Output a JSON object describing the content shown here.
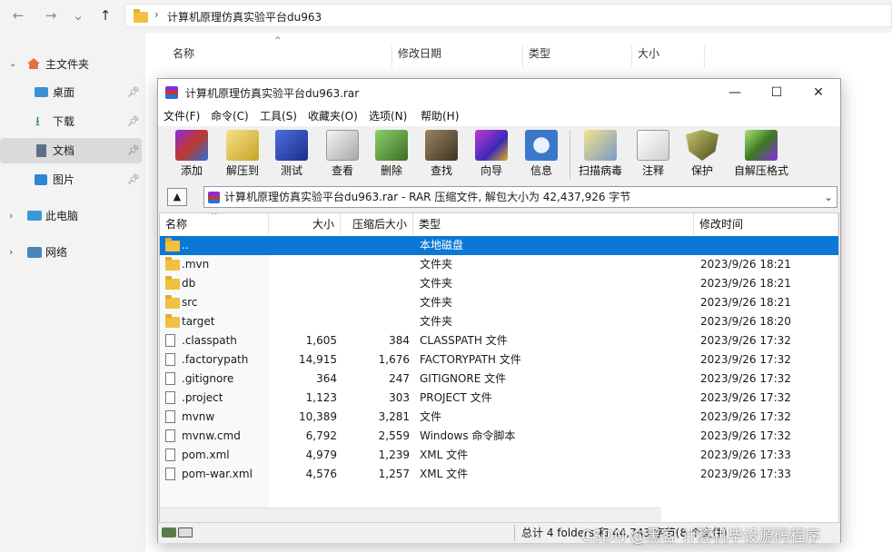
{
  "explorer": {
    "breadcrumb": "计算机原理仿真实验平台du963",
    "nav": {
      "back": "←",
      "forward": "→",
      "recent": "⌄",
      "up": "↑",
      "sep": "›"
    },
    "sidebar": {
      "home": "主文件夹",
      "desktop": "桌面",
      "downloads": "下载",
      "documents": "文档",
      "pictures": "图片",
      "this_pc": "此电脑",
      "network": "网络"
    },
    "columns": {
      "name": "名称",
      "modified": "修改日期",
      "type": "类型",
      "size": "大小"
    }
  },
  "rar": {
    "title": "计算机原理仿真实验平台du963.rar",
    "menu": [
      "文件(F)",
      "命令(C)",
      "工具(S)",
      "收藏夹(O)",
      "选项(N)",
      "帮助(H)"
    ],
    "toolbar": [
      {
        "label": "添加",
        "icon": "add-archive-icon",
        "color": "#c0392b"
      },
      {
        "label": "解压到",
        "icon": "extract-to-icon",
        "color": "#c9a227"
      },
      {
        "label": "测试",
        "icon": "test-icon",
        "color": "#2446b8"
      },
      {
        "label": "查看",
        "icon": "view-glasses-icon",
        "color": "#b8b8b8"
      },
      {
        "label": "删除",
        "icon": "delete-icon",
        "color": "#5b8c3a"
      },
      {
        "label": "查找",
        "icon": "find-binoculars-icon",
        "color": "#5a4a2e"
      },
      {
        "label": "向导",
        "icon": "wizard-icon",
        "color": "#8a2be2"
      },
      {
        "label": "信息",
        "icon": "info-icon",
        "color": "#3c78c8"
      },
      {
        "label": "扫描病毒",
        "icon": "virus-scan-icon",
        "color": "#d8c24a"
      },
      {
        "label": "注释",
        "icon": "comment-icon",
        "color": "#e6e6e6"
      },
      {
        "label": "保护",
        "icon": "protect-shield-icon",
        "color": "#7a7a3a"
      },
      {
        "label": "自解压格式",
        "icon": "sfx-icon",
        "color": "#6aa83a"
      }
    ],
    "path": "计算机原理仿真实验平台du963.rar - RAR 压缩文件, 解包大小为 42,437,926 字节",
    "columns": {
      "name": "名称",
      "size": "大小",
      "packed": "压缩后大小",
      "type": "类型",
      "modified": "修改时间"
    },
    "rows": [
      {
        "name": "..",
        "size": "",
        "packed": "",
        "type": "本地磁盘",
        "modified": "",
        "kind": "folder"
      },
      {
        "name": ".mvn",
        "size": "",
        "packed": "",
        "type": "文件夹",
        "modified": "2023/9/26 18:21",
        "kind": "folder"
      },
      {
        "name": "db",
        "size": "",
        "packed": "",
        "type": "文件夹",
        "modified": "2023/9/26 18:21",
        "kind": "folder"
      },
      {
        "name": "src",
        "size": "",
        "packed": "",
        "type": "文件夹",
        "modified": "2023/9/26 18:21",
        "kind": "folder"
      },
      {
        "name": "target",
        "size": "",
        "packed": "",
        "type": "文件夹",
        "modified": "2023/9/26 18:20",
        "kind": "folder"
      },
      {
        "name": ".classpath",
        "size": "1,605",
        "packed": "384",
        "type": "CLASSPATH 文件",
        "modified": "2023/9/26 17:32",
        "kind": "file"
      },
      {
        "name": ".factorypath",
        "size": "14,915",
        "packed": "1,676",
        "type": "FACTORYPATH 文件",
        "modified": "2023/9/26 17:32",
        "kind": "file"
      },
      {
        "name": ".gitignore",
        "size": "364",
        "packed": "247",
        "type": "GITIGNORE 文件",
        "modified": "2023/9/26 17:32",
        "kind": "file"
      },
      {
        "name": ".project",
        "size": "1,123",
        "packed": "303",
        "type": "PROJECT 文件",
        "modified": "2023/9/26 17:32",
        "kind": "file"
      },
      {
        "name": "mvnw",
        "size": "10,389",
        "packed": "3,281",
        "type": "文件",
        "modified": "2023/9/26 17:32",
        "kind": "file"
      },
      {
        "name": "mvnw.cmd",
        "size": "6,792",
        "packed": "2,559",
        "type": "Windows 命令脚本",
        "modified": "2023/9/26 17:32",
        "kind": "file"
      },
      {
        "name": "pom.xml",
        "size": "4,979",
        "packed": "1,239",
        "type": "XML 文件",
        "modified": "2023/9/26 17:33",
        "kind": "file"
      },
      {
        "name": "pom-war.xml",
        "size": "4,576",
        "packed": "1,257",
        "type": "XML 文件",
        "modified": "2023/9/26 17:33",
        "kind": "file"
      }
    ],
    "status": "总计 4 folders 和 44,743 字节(8 个文件)",
    "window_buttons": {
      "minimize": "—",
      "maximize": "☐",
      "close": "✕"
    }
  },
  "watermark": "CSDN @黑客 计算机毕设源码程序",
  "colors": {
    "selection": "#0a78d4",
    "folder": "#f0c040"
  }
}
